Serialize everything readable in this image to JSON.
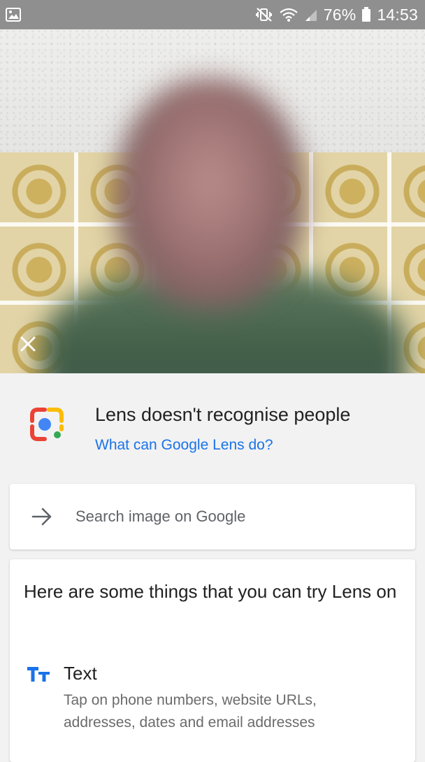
{
  "status_bar": {
    "battery": "76%",
    "time": "14:53",
    "left_icon": "gallery-notification-icon",
    "icons": [
      "mute-vibrate-icon",
      "wifi-icon",
      "signal-icon",
      "battery-icon"
    ]
  },
  "camera": {
    "close_icon": "close-icon"
  },
  "lens": {
    "logo_icon": "google-lens-logo-icon",
    "title": "Lens doesn't recognise people",
    "link": "What can Google Lens do?"
  },
  "search": {
    "icon": "arrow-right-icon",
    "label": "Search image on Google"
  },
  "suggestions": {
    "heading": "Here are some things that you can try Lens on",
    "items": [
      {
        "icon": "text-format-icon",
        "title": "Text",
        "description": "Tap on phone numbers, website URLs, addresses, dates and email addresses"
      }
    ]
  },
  "colors": {
    "accent_blue": "#1a73e8",
    "lens_red": "#ea4335",
    "lens_yellow": "#fbbc04",
    "lens_green": "#34a853",
    "status_bar": "#8f8f8f"
  }
}
